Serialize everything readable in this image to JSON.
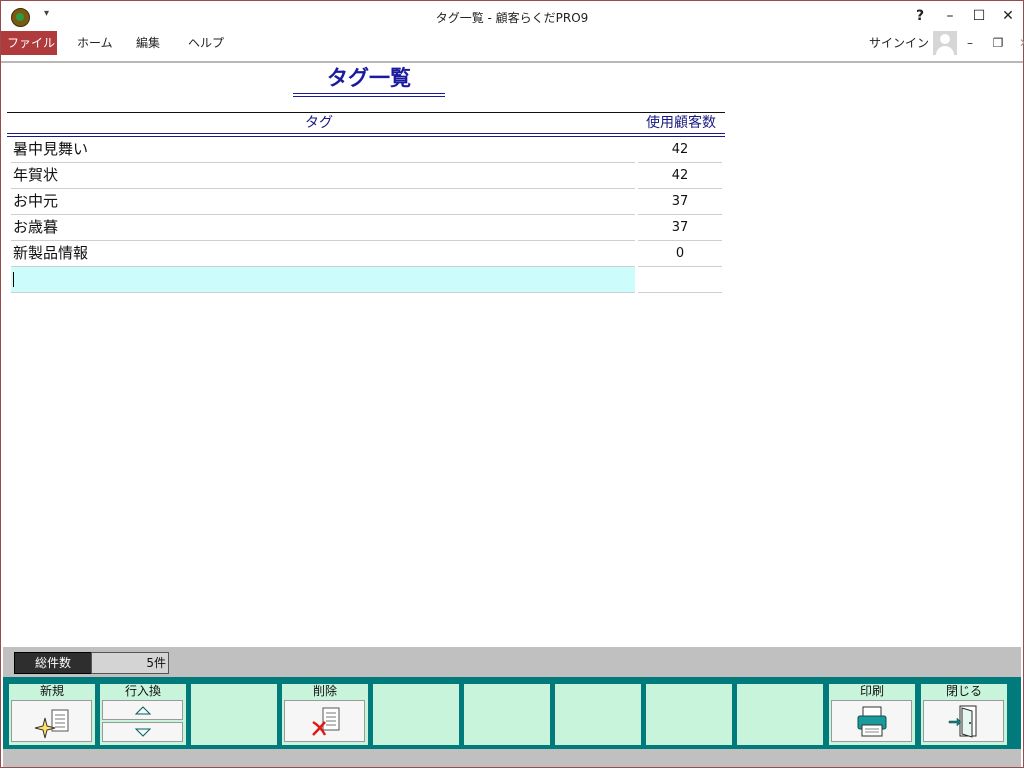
{
  "window": {
    "title": "タグ一覧 - 顧客らくだPRO9"
  },
  "menu": {
    "file": "ファイル",
    "home": "ホーム",
    "edit": "編集",
    "help": "ヘルプ",
    "signin": "サインイン"
  },
  "page": {
    "title": "タグ一覧"
  },
  "table": {
    "headers": {
      "tag": "タグ",
      "count": "使用顧客数"
    },
    "rows": [
      {
        "tag": "暑中見舞い",
        "count": "42"
      },
      {
        "tag": "年賀状",
        "count": "42"
      },
      {
        "tag": "お中元",
        "count": "37"
      },
      {
        "tag": "お歳暮",
        "count": "37"
      },
      {
        "tag": "新製品情報",
        "count": "0"
      }
    ]
  },
  "status": {
    "total_label": "総件数",
    "total_value": "5件"
  },
  "toolbar": {
    "new_label": "新規",
    "reorder_label": "行入換",
    "delete_label": "削除",
    "print_label": "印刷",
    "close_label": "閉じる"
  },
  "colors": {
    "accent_file_menu": "#b03b3c",
    "title_blue": "#1a1aa0",
    "function_bar": "#007a7a",
    "function_key": "#c8f4dc",
    "edit_row": "#ccfcfc"
  },
  "icons": {
    "new": "new-sparkle-document-icon",
    "move_up": "triangle-up-icon",
    "move_down": "triangle-down-icon",
    "delete": "delete-x-document-icon",
    "print": "printer-icon",
    "close": "exit-door-icon"
  }
}
